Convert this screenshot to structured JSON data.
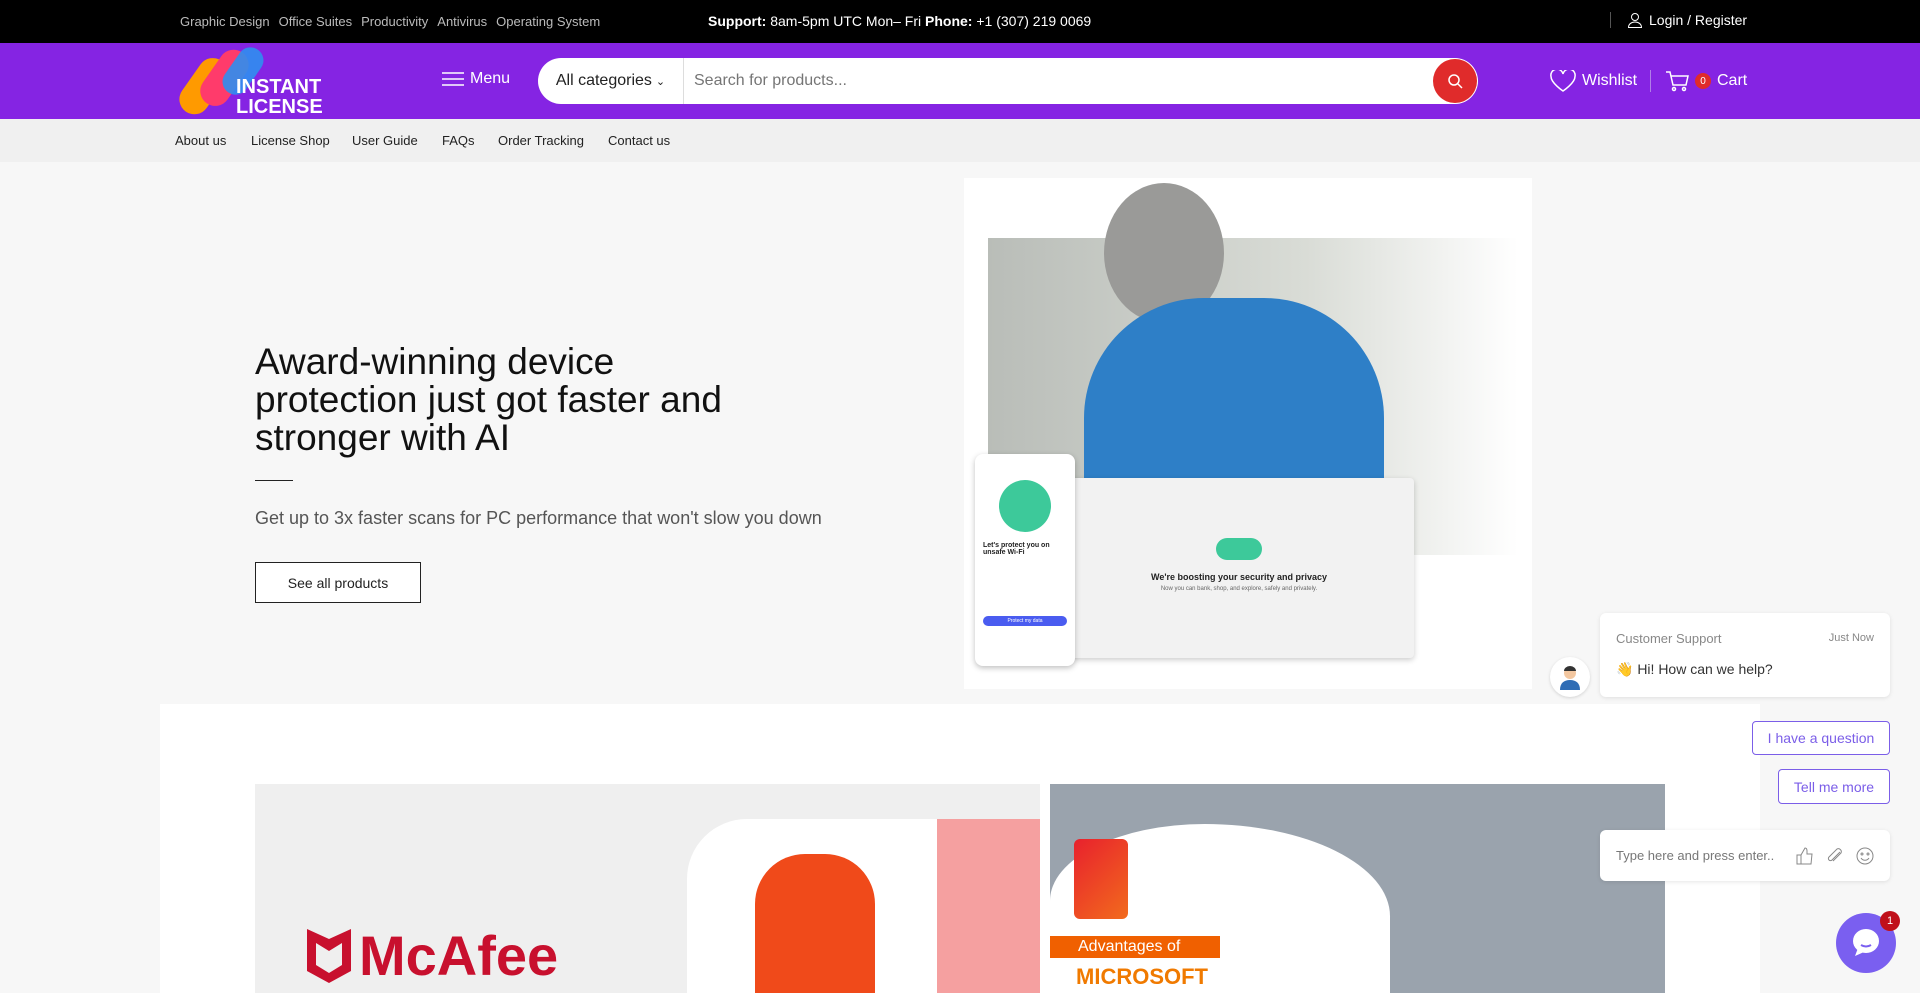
{
  "topbar": {
    "categories": [
      "Graphic Design",
      "Office Suites",
      "Productivity",
      "Antivirus",
      "Operating System"
    ],
    "support_label": "Support:",
    "support_hours": "8am-5pm UTC Mon– Fri",
    "phone_label": "Phone:",
    "phone": "+1 (307) 219 0069",
    "login": "Login / Register"
  },
  "header": {
    "logo_text": "INSTANT LICENSE",
    "menu": "Menu",
    "category": "All categories",
    "search_placeholder": "Search for products...",
    "wishlist": "Wishlist",
    "cart": "Cart",
    "cart_count": "0",
    "brand_color": "#8524e3",
    "accent_color": "#e02b2b"
  },
  "nav": [
    "About us",
    "License Shop",
    "User Guide",
    "FAQs",
    "Order Tracking",
    "Contact us"
  ],
  "hero": {
    "title": "Award-winning device protection just got faster and stronger with AI",
    "subtitle": "Get up to 3x faster scans for PC performance that won't slow you down",
    "cta": "See all products",
    "phone_title": "Let's protect you on unsafe Wi-Fi",
    "phone_button": "Protect my data",
    "desktop_title": "We're boosting your security and privacy",
    "desktop_sub": "Now you can bank, shop, and explore, safely and privately."
  },
  "banners": {
    "mcafee": "McAfee",
    "ms_line1": "Advantages of",
    "ms_line2": "MICROSOFT"
  },
  "chat": {
    "agent": "Customer Support",
    "time": "Just Now",
    "message": "👋 Hi! How can we help?",
    "options": [
      "I have a question",
      "Tell me more"
    ],
    "input_placeholder": "Type here and press enter..",
    "unread": "1",
    "accent": "#7a5ff0"
  }
}
